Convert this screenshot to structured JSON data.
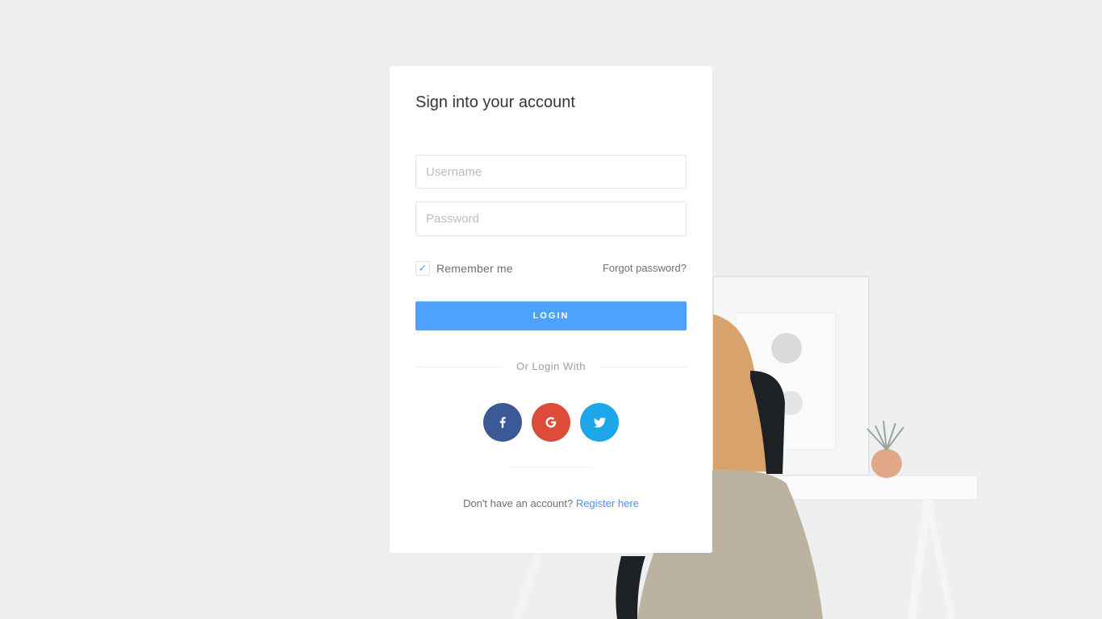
{
  "login_card": {
    "title": "Sign into your account",
    "username": {
      "placeholder": "Username",
      "value": ""
    },
    "password": {
      "placeholder": "Password",
      "value": ""
    },
    "remember": {
      "label": "Remember me",
      "checked": true
    },
    "forgot_link": "Forgot password?",
    "login_button": "LOGIN",
    "divider_text": "Or Login With",
    "social": [
      {
        "name": "facebook",
        "icon": "facebook-icon",
        "color": "#3b5897"
      },
      {
        "name": "google",
        "icon": "google-icon",
        "color": "#dd4b39"
      },
      {
        "name": "twitter",
        "icon": "twitter-icon",
        "color": "#1da6e9"
      }
    ],
    "footer_text": "Don't have an account?",
    "register_link": "Register here"
  },
  "colors": {
    "accent": "#4da2ff",
    "background": "#eeeff1"
  }
}
